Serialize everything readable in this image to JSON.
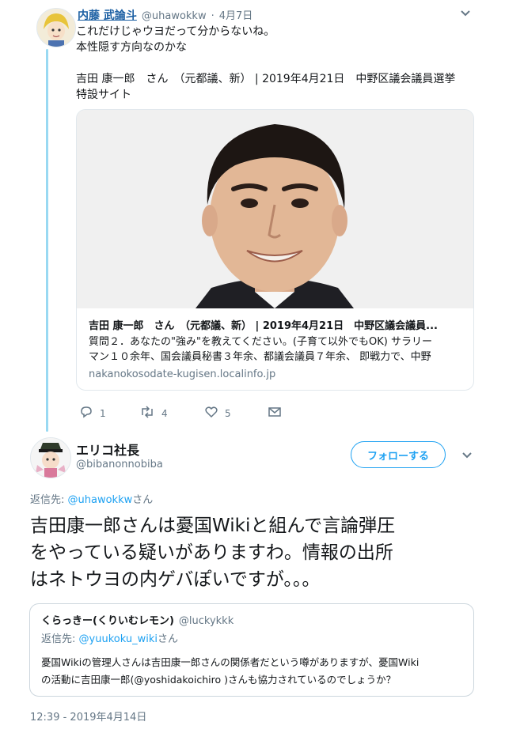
{
  "tweet1": {
    "author_name": "内藤 武論斗",
    "handle": "@uhawokkw",
    "separator": "·",
    "date": "4月7日",
    "lines": [
      "これだけじゃウヨだって分からないね。",
      "本性隠す方向なのかな"
    ],
    "link_title_lines": [
      "吉田 康一郎　さん　（元都議、新） | 2019年4月21日　中野区議会議員選挙",
      "特設サイト"
    ],
    "card": {
      "title": "吉田 康一郎　さん　（元都議、新） | 2019年4月21日　中野区議会議員...",
      "desc_lines": [
        "質問２．あなたの\"強み\"を教えてください。(子育て以外でもOK) サラリー",
        "マン１０余年、国会議員秘書３年余、都議会議員７年余、 即戦力で、中野"
      ],
      "domain": "nakanokosodate-kugisen.localinfo.jp"
    },
    "actions": {
      "replies": "1",
      "retweets": "4",
      "likes": "5"
    }
  },
  "tweet2": {
    "author_name": "エリコ社長",
    "handle": "@bibanonnobiba",
    "follow_label": "フォローする",
    "reply_prefix": "返信先: ",
    "reply_to": "@uhawokkw",
    "reply_suffix": "さん",
    "text_lines": [
      "吉田康一郎さんは憂国Wikiと組んで言論弾圧",
      "をやっている疑いがありますわ。情報の出所",
      "はネトウヨの内ゲバぽいですが。。。"
    ],
    "quote": {
      "author_name": "くらっきー(くりいむレモン)",
      "handle": "@luckykkk",
      "reply_prefix": "返信先: ",
      "reply_to": "@yuukoku_wiki",
      "reply_suffix": "さん",
      "text_lines": [
        "憂国Wikiの管理人さんは吉田康一郎さんの関係者だという噂がありますが、憂国Wiki",
        "の活動に吉田康一郎(@yoshidakoichiro )さんも協力されているのでしょうか？"
      ]
    },
    "timestamp": "12:39 - 2019年4月14日"
  },
  "colors": {
    "accent": "#1da1f2",
    "thread_line": "#99d9f2",
    "muted": "#657786"
  }
}
